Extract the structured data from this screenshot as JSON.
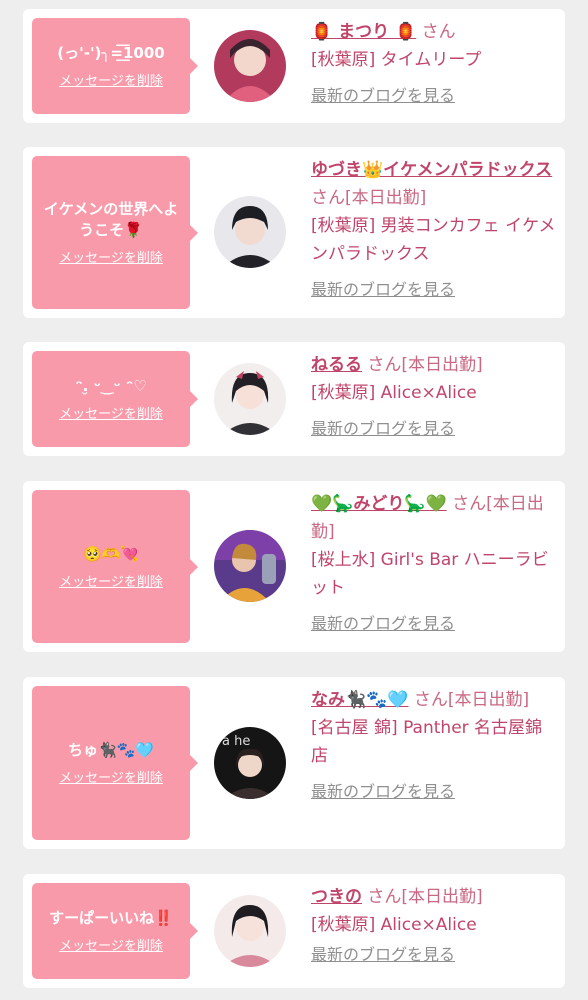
{
  "delete_label": "メッセージを削除",
  "blog_label": "最新のブログを見る",
  "honorific": "さん",
  "colors": {
    "bubble": "#f99aaa",
    "name": "#c0456a",
    "link_gray": "#8f8f8f",
    "background": "#eeeeee"
  },
  "cards": [
    {
      "message": "(っ'-')╮=͟͟͞͞1000",
      "name": "🏮 まつり 🏮",
      "status": "",
      "shop": "[秋葉原] タイムリープ",
      "avatar_icon": "avatar-photo"
    },
    {
      "message": "イケメンの世界へようこそ🌹",
      "name": "ゆづき👑イケメンパラドックス",
      "status": "[本日出勤]",
      "shop": "[秋葉原] 男装コンカフェ イケメンパラドックス",
      "avatar_icon": "avatar-photo"
    },
    {
      "message": "ᵔ.̮ ᵕ‿ᵕ ᵔ♡",
      "name": "ねるる",
      "status": "[本日出勤]",
      "shop": "[秋葉原] Alice×Alice",
      "avatar_icon": "avatar-photo"
    },
    {
      "message": "🥺🫶💘",
      "name": "💚🦕みどり🦕💚",
      "status": "[本日出勤]",
      "shop": "[桜上水] Girl's Bar ハニーラビット",
      "avatar_icon": "avatar-photo"
    },
    {
      "message": "ちゅ🐈‍⬛🐾🩵",
      "name": "なみ🐈‍⬛🐾🩵",
      "status": "[本日出勤]",
      "shop": "[名古屋 錦] Panther 名古屋錦店",
      "avatar_icon": "avatar-photo"
    },
    {
      "message": "すーぱーいいね‼️",
      "name": "つきの",
      "status": "[本日出勤]",
      "shop": "[秋葉原] Alice×Alice",
      "avatar_icon": "avatar-photo"
    }
  ]
}
